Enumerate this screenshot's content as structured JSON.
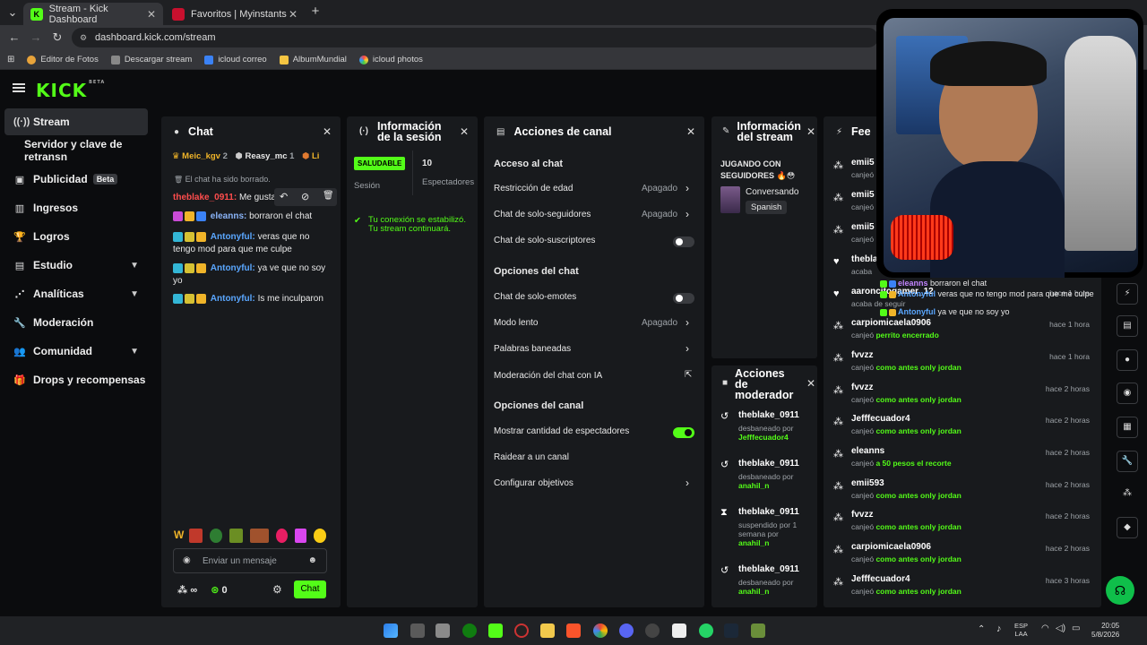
{
  "browser": {
    "tabs": [
      {
        "title": "Stream - Kick Dashboard",
        "active": true
      },
      {
        "title": "Favoritos | Myinstants",
        "active": false
      }
    ],
    "url": "dashboard.kick.com/stream",
    "bookmarks": [
      "Editor de Fotos",
      "Descargar stream",
      "icloud correo",
      "AlbumMundial",
      "icloud photos"
    ]
  },
  "kick": {
    "logo": "KICK",
    "logo_sup": "BETA"
  },
  "sidebar": {
    "items": [
      {
        "label": "Stream",
        "icon": "broadcast-icon"
      },
      {
        "label": "Servidor y clave de retransn",
        "icon": ""
      },
      {
        "label": "Publicidad",
        "icon": "ad-icon",
        "badge": "Beta"
      },
      {
        "label": "Ingresos",
        "icon": "chart-icon"
      },
      {
        "label": "Logros",
        "icon": "trophy-icon"
      },
      {
        "label": "Estudio",
        "icon": "studio-icon"
      },
      {
        "label": "Analíticas",
        "icon": "analytics-icon"
      },
      {
        "label": "Moderación",
        "icon": "wrench-icon"
      },
      {
        "label": "Comunidad",
        "icon": "community-icon"
      },
      {
        "label": "Drops y recompensas",
        "icon": "gift-icon"
      }
    ]
  },
  "chat": {
    "title": "Chat",
    "top_users": [
      {
        "name": "Meic_kgv",
        "rank": "2"
      },
      {
        "name": "Reasy_mc",
        "rank": "1"
      },
      {
        "name": "Li",
        "rank": ""
      }
    ],
    "deleted_notice": "El chat ha sido borrado.",
    "messages": [
      {
        "user": "theblake_0911:",
        "text": "Me gusta"
      },
      {
        "user": "eleanns:",
        "text": "borraron el chat"
      },
      {
        "user": "Antonyful:",
        "text": "veras que no",
        "text2": "tengo mod para que me culpe"
      },
      {
        "user": "Antonyful:",
        "text": "ya ve que no soy",
        "text2": "yo"
      },
      {
        "user": "Antonyful:",
        "text": "Is me inculparon"
      }
    ],
    "input_placeholder": "Enviar un mensaje",
    "points": "0",
    "infinity": "∞",
    "send_label": "Chat"
  },
  "session": {
    "title_line1": "Información",
    "title_line2": "de la sesión",
    "status": "SALUDABLE",
    "status_label": "Sesión",
    "viewers": "10",
    "viewers_label": "Espectadores",
    "notice_line1": "Tu conexión se estabilizó.",
    "notice_line2": "Tu stream continuará."
  },
  "actions": {
    "title": "Acciones de canal",
    "section1": "Acceso al chat",
    "section2": "Opciones del chat",
    "section3": "Opciones del canal",
    "rows": {
      "age": "Restricción de edad",
      "age_val": "Apagado",
      "followers": "Chat de solo-seguidores",
      "followers_val": "Apagado",
      "subs": "Chat de solo-suscriptores",
      "emotes": "Chat de solo-emotes",
      "slow": "Modo lento",
      "slow_val": "Apagado",
      "banned": "Palabras baneadas",
      "ai": "Moderación del chat con IA",
      "show_viewers": "Mostrar cantidad de espectadores",
      "raid": "Raidear a un canal",
      "goals": "Configurar objetivos"
    }
  },
  "stream_info": {
    "title_line1": "Información",
    "title_line2": "del stream",
    "category_line1": "JUGANDO CON",
    "category_line2": "SEGUIDORES 🔥😳",
    "game": "Conversando",
    "language": "Spanish"
  },
  "mod_actions": {
    "title_line1": "Acciones",
    "title_line2": "de",
    "title_line3": "moderador",
    "rows": [
      {
        "user": "theblake_0911",
        "d1": "desbaneado por",
        "d2": "Jefffecuador4",
        "icon": "undo-icon"
      },
      {
        "user": "theblake_0911",
        "d1": "desbaneado por",
        "d2": "anahil_n",
        "icon": "undo-icon"
      },
      {
        "user": "theblake_0911",
        "d1": "suspendido por 1",
        "d2": "semana por",
        "d3": "anahil_n",
        "icon": "hourglass-icon"
      },
      {
        "user": "theblake_0911",
        "d1": "desbaneado por",
        "d2": "anahil_n",
        "icon": "undo-icon"
      }
    ]
  },
  "feed": {
    "title": "Fee",
    "overlay_msgs": [
      {
        "user": "eleanns",
        "text": "borraron el chat"
      },
      {
        "user": "Antonyful",
        "text": "veras que no tengo mod para que me culpe"
      },
      {
        "user": "Antonyful",
        "text": "ya ve que no soy yo"
      }
    ],
    "rows": [
      {
        "user": "emii5",
        "desc": "canjeó",
        "reward": "",
        "time": ""
      },
      {
        "user": "emii5",
        "desc": "canjeó",
        "reward": "",
        "time": ""
      },
      {
        "user": "emii5",
        "desc": "canjeó",
        "reward": "",
        "time": ""
      },
      {
        "user": "thebla",
        "desc": "acaba",
        "reward": "",
        "time": ""
      },
      {
        "user": "aaroncitogamer_12",
        "desc": "acaba de seguir",
        "reward": "",
        "time": "hace 1 hora"
      },
      {
        "user": "carpiomicaela0906",
        "desc": "canjeó",
        "reward": "perrito encerrado",
        "time": "hace 1 hora"
      },
      {
        "user": "fvvzz",
        "desc": "canjeó",
        "reward": "como antes only jordan",
        "time": "hace 1 hora"
      },
      {
        "user": "fvvzz",
        "desc": "canjeó",
        "reward": "como antes only jordan",
        "time": "hace 2 horas"
      },
      {
        "user": "Jefffecuador4",
        "desc": "canjeó",
        "reward": "como antes only jordan",
        "time": "hace 2 horas"
      },
      {
        "user": "eleanns",
        "desc": "canjeó",
        "reward": "a 50 pesos el recorte",
        "time": "hace 2 horas"
      },
      {
        "user": "emii593",
        "desc": "canjeó",
        "reward": "como antes only jordan",
        "time": "hace 2 horas"
      },
      {
        "user": "fvvzz",
        "desc": "canjeó",
        "reward": "como antes only jordan",
        "time": "hace 2 horas"
      },
      {
        "user": "carpiomicaela0906",
        "desc": "canjeó",
        "reward": "como antes only jordan",
        "time": "hace 2 horas"
      },
      {
        "user": "Jefffecuador4",
        "desc": "canjeó",
        "reward": "como antes only jordan",
        "time": "hace 3 horas"
      }
    ]
  },
  "taskbar": {
    "lang1": "ESP",
    "lang2": "LAA",
    "time": "20:05",
    "date": "5/8/2026"
  },
  "colors": {
    "accent": "#53fc18",
    "panel": "#181a1d",
    "bg": "#0b0c0e"
  }
}
